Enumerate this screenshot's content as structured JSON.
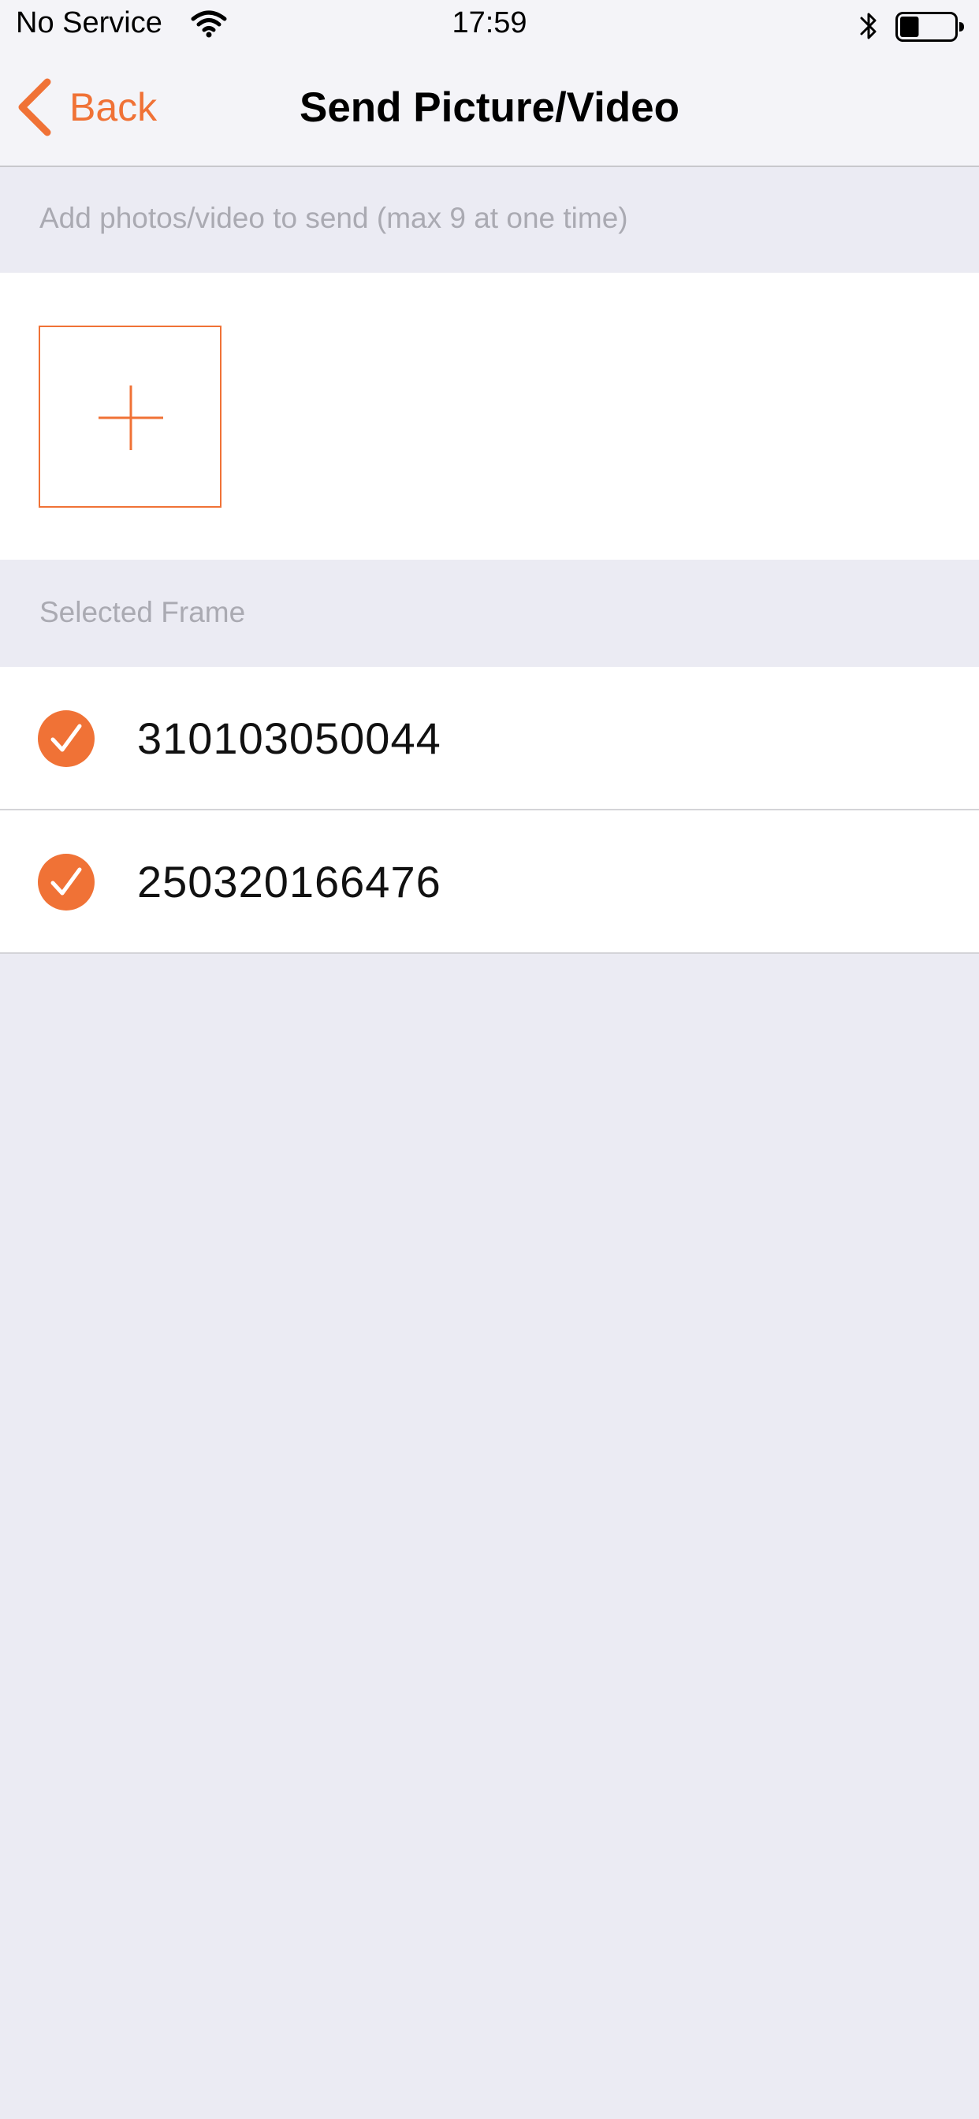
{
  "status_bar": {
    "carrier": "No Service",
    "time": "17:59",
    "icons": [
      "wifi-icon",
      "bluetooth-icon",
      "battery-icon"
    ],
    "battery_level": 0.35
  },
  "nav": {
    "back_label": "Back",
    "title": "Send Picture/Video"
  },
  "add_section": {
    "header": "Add photos/video to send (max 9 at one time)",
    "add_button_icon": "plus-icon"
  },
  "frame_section": {
    "header": "Selected Frame",
    "frames": [
      {
        "label": "310103050044",
        "selected": true
      },
      {
        "label": "250320166476",
        "selected": true
      }
    ]
  },
  "colors": {
    "accent": "#f07236",
    "background": "#ebebf3",
    "surface": "#ffffff",
    "nav_background": "#f4f4f8",
    "header_text": "#aaaab2"
  }
}
